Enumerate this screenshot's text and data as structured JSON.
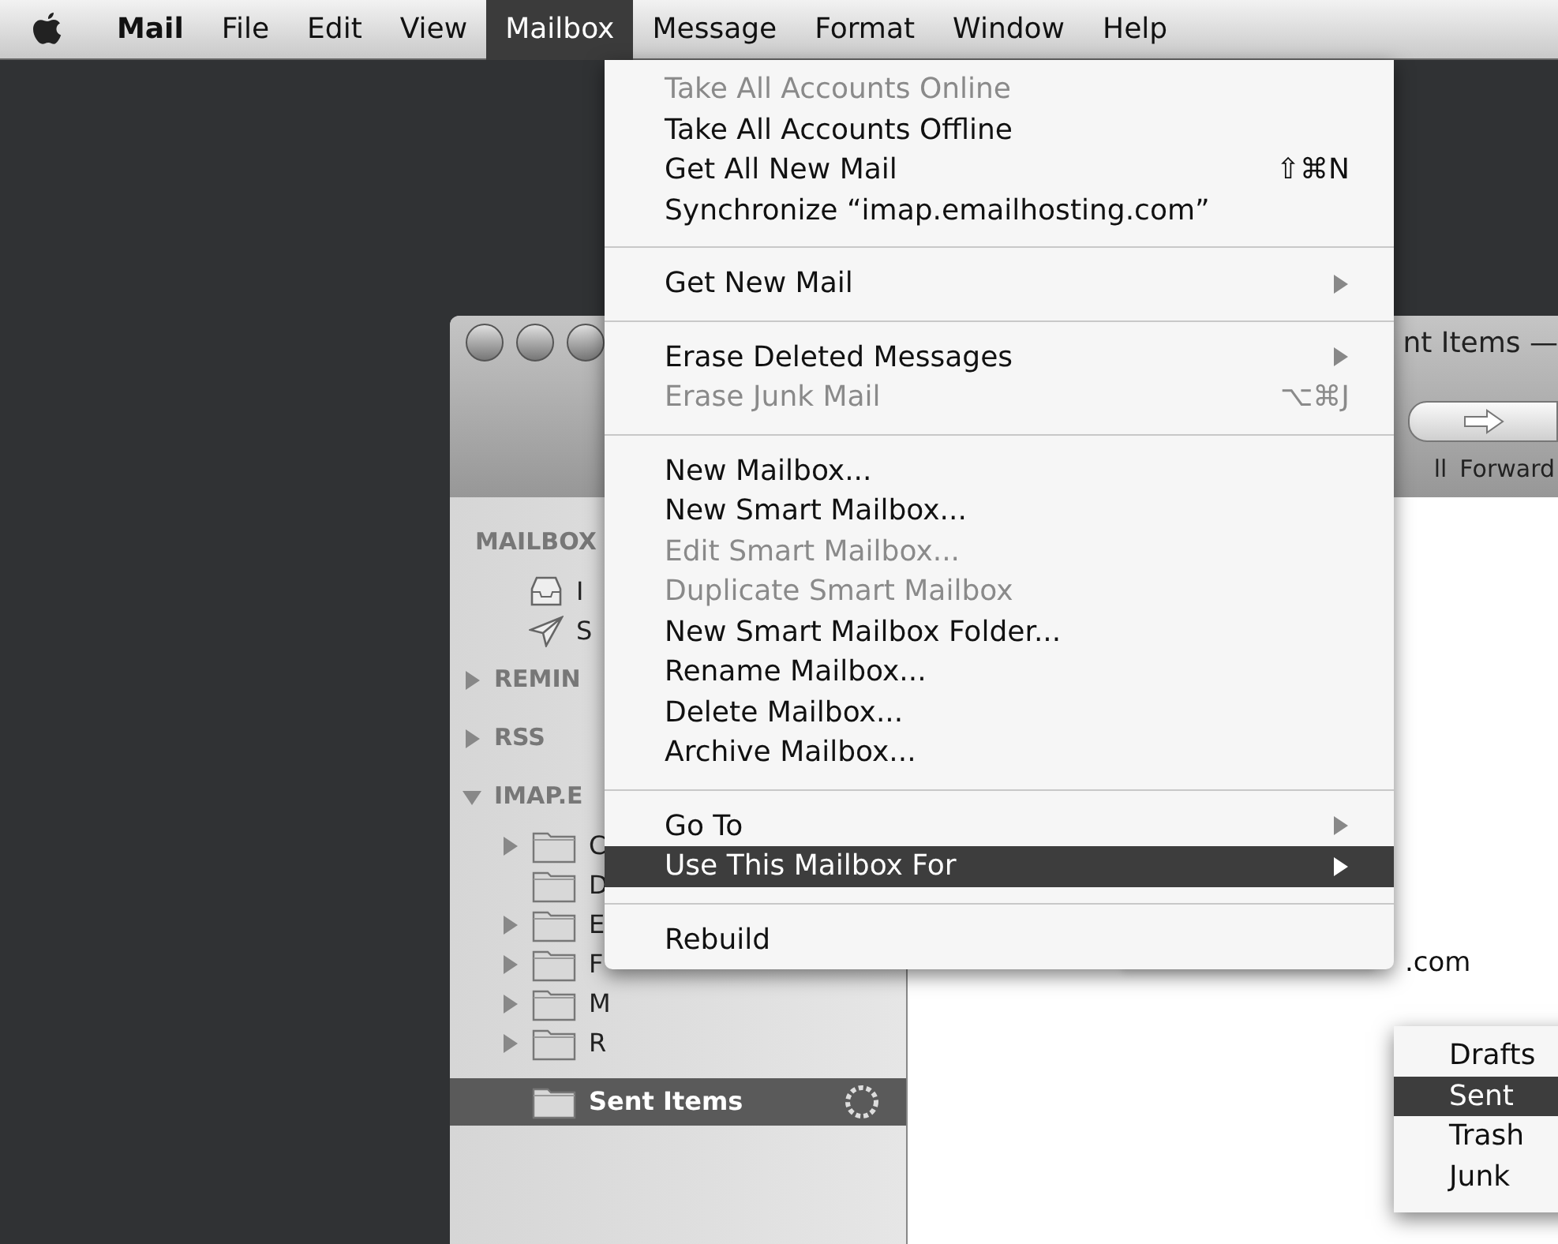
{
  "menu_bar": {
    "items": [
      {
        "label": "Mail",
        "kind": "app",
        "selected": false
      },
      {
        "label": "File",
        "kind": "menu",
        "selected": false
      },
      {
        "label": "Edit",
        "kind": "menu",
        "selected": false
      },
      {
        "label": "View",
        "kind": "menu",
        "selected": false
      },
      {
        "label": "Mailbox",
        "kind": "menu",
        "selected": true
      },
      {
        "label": "Message",
        "kind": "menu",
        "selected": false
      },
      {
        "label": "Format",
        "kind": "menu",
        "selected": false
      },
      {
        "label": "Window",
        "kind": "menu",
        "selected": false
      },
      {
        "label": "Help",
        "kind": "menu",
        "selected": false
      }
    ]
  },
  "mail_window": {
    "title": "nt Items —",
    "toolbar_labels": [
      "ll",
      "Forward"
    ],
    "sidebar": [
      {
        "kind": "header",
        "label": "MAILBOX",
        "selected": false
      },
      {
        "kind": "inbox",
        "label": "I",
        "selected": false
      },
      {
        "kind": "sent",
        "label": "S",
        "selected": false
      },
      {
        "kind": "header",
        "label": "REMIN",
        "expanded": false,
        "selected": false
      },
      {
        "kind": "header",
        "label": "RSS",
        "expanded": false,
        "selected": false
      },
      {
        "kind": "header",
        "label": "IMAP.E",
        "expanded": true,
        "selected": false
      },
      {
        "kind": "folder",
        "label": "C",
        "expanded": false,
        "selected": false
      },
      {
        "kind": "folder",
        "label": "D",
        "selected": false
      },
      {
        "kind": "folder",
        "label": "E",
        "expanded": false,
        "selected": false
      },
      {
        "kind": "folder",
        "label": "F",
        "expanded": false,
        "selected": false
      },
      {
        "kind": "folder",
        "label": "M",
        "expanded": false,
        "selected": false
      },
      {
        "kind": "folder",
        "label": "R",
        "expanded": false,
        "selected": false
      },
      {
        "kind": "folder",
        "label": "Sent Items",
        "selected": true
      }
    ],
    "message_list": {
      "visible_text": ".com"
    }
  },
  "mailbox_menu": {
    "items": [
      {
        "kind": "item",
        "label": "Take All Accounts Online",
        "disabled": true,
        "selected": false
      },
      {
        "kind": "item",
        "label": "Take All Accounts Offline",
        "disabled": false,
        "selected": false
      },
      {
        "kind": "item",
        "label": "Get All New Mail",
        "shortcut": "⇧⌘N",
        "disabled": false,
        "selected": false
      },
      {
        "kind": "item",
        "label": "Synchronize “imap.emailhosting.com”",
        "disabled": false,
        "selected": false
      },
      {
        "kind": "separator"
      },
      {
        "kind": "item",
        "label": "Get New Mail",
        "submenu": true,
        "disabled": false,
        "selected": false
      },
      {
        "kind": "separator"
      },
      {
        "kind": "item",
        "label": "Erase Deleted Messages",
        "submenu": true,
        "disabled": false,
        "selected": false
      },
      {
        "kind": "item",
        "label": "Erase Junk Mail",
        "shortcut": "⌥⌘J",
        "disabled": true,
        "selected": false
      },
      {
        "kind": "separator"
      },
      {
        "kind": "item",
        "label": "New Mailbox...",
        "disabled": false,
        "selected": false
      },
      {
        "kind": "item",
        "label": "New Smart Mailbox...",
        "disabled": false,
        "selected": false
      },
      {
        "kind": "item",
        "label": "Edit Smart Mailbox...",
        "disabled": true,
        "selected": false
      },
      {
        "kind": "item",
        "label": "Duplicate Smart Mailbox",
        "disabled": true,
        "selected": false
      },
      {
        "kind": "item",
        "label": "New Smart Mailbox Folder...",
        "disabled": false,
        "selected": false
      },
      {
        "kind": "item",
        "label": "Rename Mailbox...",
        "disabled": false,
        "selected": false
      },
      {
        "kind": "item",
        "label": "Delete Mailbox...",
        "disabled": false,
        "selected": false
      },
      {
        "kind": "item",
        "label": "Archive Mailbox...",
        "disabled": false,
        "selected": false
      },
      {
        "kind": "separator"
      },
      {
        "kind": "item",
        "label": "Go To",
        "submenu": true,
        "disabled": false,
        "selected": false
      },
      {
        "kind": "item",
        "label": "Use This Mailbox For",
        "submenu": true,
        "disabled": false,
        "selected": true
      },
      {
        "kind": "separator"
      },
      {
        "kind": "item",
        "label": "Rebuild",
        "disabled": false,
        "selected": false
      }
    ]
  },
  "submenu": {
    "items": [
      {
        "label": "Drafts",
        "selected": false
      },
      {
        "label": "Sent",
        "selected": true
      },
      {
        "label": "Trash",
        "selected": false
      },
      {
        "label": "Junk",
        "selected": false
      }
    ]
  }
}
